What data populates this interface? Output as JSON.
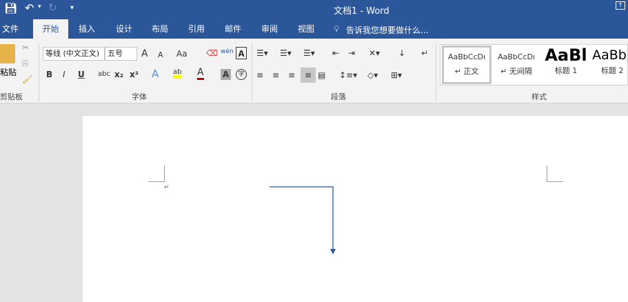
{
  "titlebar": {
    "title": "文档1 - Word",
    "save": "save-icon",
    "undo": "undo-icon",
    "redo": "redo-icon",
    "customize": "▾"
  },
  "tabs": [
    {
      "label": "文件"
    },
    {
      "label": "开始"
    },
    {
      "label": "插入"
    },
    {
      "label": "设计"
    },
    {
      "label": "布局"
    },
    {
      "label": "引用"
    },
    {
      "label": "邮件"
    },
    {
      "label": "审阅"
    },
    {
      "label": "视图"
    }
  ],
  "tell_me": "告诉我您想要做什么...",
  "groups": {
    "clipboard": "剪贴板",
    "font": "字体",
    "paragraph": "段落",
    "styles": "样式"
  },
  "clipboard": {
    "paste": "粘贴"
  },
  "font": {
    "name": "等线 (中文正文)",
    "size": "五号",
    "bold": "B",
    "italic": "I",
    "underline": "U",
    "strike": "abc",
    "sub": "x₂",
    "sup": "x²",
    "case": "Aa",
    "grow": "A",
    "shrink": "A",
    "phonetic": "wén",
    "border": "A",
    "color": "A",
    "shade": "A",
    "enclose": "字",
    "effects": "A",
    "highlight": "ab"
  },
  "styles": [
    {
      "preview": "AaBbCcDı",
      "label": "↵ 正文"
    },
    {
      "preview": "AaBbCcDı",
      "label": "↵ 无间隔"
    },
    {
      "preview": "AaBl",
      "label": "标题 1"
    },
    {
      "preview": "AaBb",
      "label": "标题 2"
    }
  ],
  "document": {
    "paragraph_mark": "↵"
  }
}
